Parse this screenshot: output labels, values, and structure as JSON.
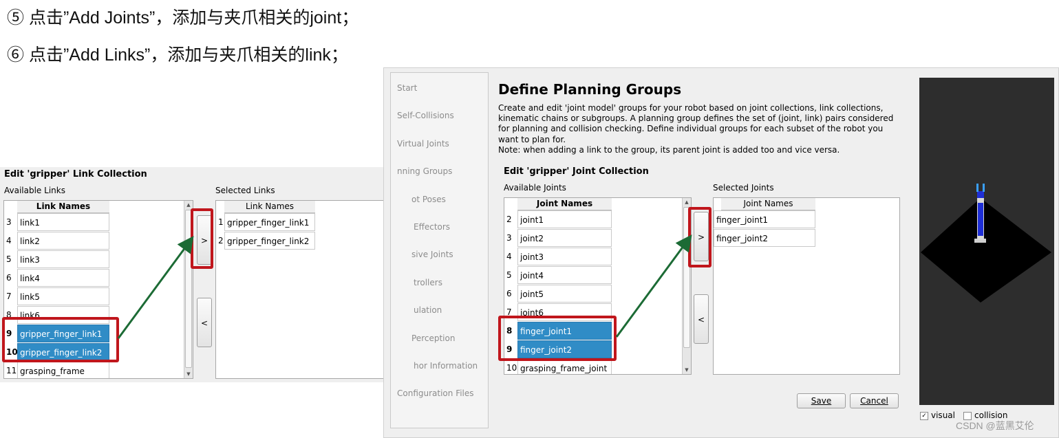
{
  "captions": {
    "step5": "⑤ 点击”Add Joints”，添加与夹爪相关的joint；",
    "step6": "⑥ 点击”Add Links”，添加与夹爪相关的link；"
  },
  "link_collection": {
    "title": "Edit 'gripper' Link Collection",
    "available_label": "Available Links",
    "selected_label": "Selected Links",
    "available_header": "Link Names",
    "selected_header": "Link Names",
    "available_rows": [
      {
        "num": "3",
        "name": "link1"
      },
      {
        "num": "4",
        "name": "link2"
      },
      {
        "num": "5",
        "name": "link3"
      },
      {
        "num": "6",
        "name": "link4"
      },
      {
        "num": "7",
        "name": "link5"
      },
      {
        "num": "8",
        "name": "link6"
      },
      {
        "num": "9",
        "name": "gripper_finger_link1"
      },
      {
        "num": "10",
        "name": "gripper_finger_link2"
      },
      {
        "num": "11",
        "name": "grasping_frame"
      }
    ],
    "selected_rows": [
      {
        "num": "1",
        "name": "gripper_finger_link1"
      },
      {
        "num": "2",
        "name": "gripper_finger_link2"
      }
    ],
    "add_button": ">",
    "remove_button": "<"
  },
  "window": {
    "nav": [
      "Start",
      "Self-Collisions",
      "Virtual Joints",
      "Planning Groups",
      "Robot Poses",
      "End Effectors",
      "Passive Joints",
      "Controllers",
      "Simulation",
      "Perception",
      "Author Information",
      "Configuration Files"
    ],
    "nav_visible": [
      "Start",
      "Self-Collisions",
      "Virtual Joints",
      "nning Groups",
      "ot Poses",
      "Effectors",
      "sive Joints",
      "trollers",
      "ulation",
      "Perception",
      "hor Information",
      "Configuration Files"
    ],
    "page_title": "Define Planning Groups",
    "description": [
      "Create and edit 'joint model' groups for your robot based on joint collections, link collections,",
      "kinematic chains or subgroups. A planning group defines the set of (joint, link) pairs considered",
      "for planning and collision checking. Define individual groups for each subset of the robot you",
      "want to plan for.",
      "Note: when adding a link to the group, its parent joint is added too and vice versa."
    ],
    "joint_collection": {
      "title": "Edit 'gripper' Joint Collection",
      "available_label": "Available Joints",
      "selected_label": "Selected Joints",
      "available_header": "Joint Names",
      "selected_header": "Joint Names",
      "available_rows": [
        {
          "num": "2",
          "name": "joint1"
        },
        {
          "num": "3",
          "name": "joint2"
        },
        {
          "num": "4",
          "name": "joint3"
        },
        {
          "num": "5",
          "name": "joint4"
        },
        {
          "num": "6",
          "name": "joint5"
        },
        {
          "num": "7",
          "name": "joint6"
        },
        {
          "num": "8",
          "name": "finger_joint1"
        },
        {
          "num": "9",
          "name": "finger_joint2"
        },
        {
          "num": "10",
          "name": "grasping_frame_joint"
        }
      ],
      "selected_rows": [
        {
          "num": "1",
          "name": "finger_joint1"
        },
        {
          "num": "2",
          "name": "finger_joint2"
        }
      ],
      "add_button": ">",
      "remove_button": "<"
    },
    "save_button": "Save",
    "cancel_button": "Cancel",
    "visual_label": "visual",
    "visual_checked": true,
    "collision_label": "collision",
    "collision_checked": false
  },
  "watermark": "CSDN @蓝黑艾伦",
  "colors": {
    "selection": "#308cc6",
    "highlight_box": "#c0161c",
    "arrow": "#1c6b35"
  }
}
